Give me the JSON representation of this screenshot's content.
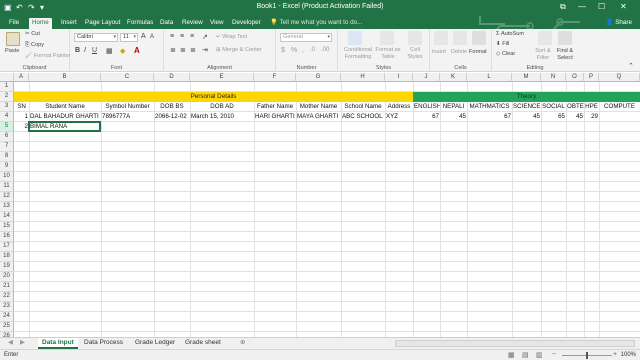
{
  "window": {
    "title": "Book1 - Excel (Product Activation Failed)",
    "controls": [
      "⧉",
      "—",
      "☐",
      "✕"
    ]
  },
  "ribbon_tabs": [
    "File",
    "Home",
    "Insert",
    "Page Layout",
    "Formulas",
    "Data",
    "Review",
    "View",
    "Developer"
  ],
  "tell_me": "Tell me what you want to do...",
  "share": "Share",
  "clipboard": {
    "paste": "Paste",
    "cut": "Cut",
    "copy": "Copy",
    "format_painter": "Format Painter",
    "label": "Clipboard"
  },
  "font": {
    "name": "Calibri",
    "size": "11",
    "label": "Font"
  },
  "alignment": {
    "wrap": "Wrap Text",
    "merge": "Merge & Center",
    "label": "Alignment"
  },
  "number": {
    "format": "General",
    "label": "Number"
  },
  "styles": {
    "conditional": "Conditional Formatting",
    "table": "Format as Table",
    "cell": "Cell Styles",
    "label": "Styles"
  },
  "cells": {
    "insert": "Insert",
    "delete": "Delete",
    "format": "Format",
    "label": "Cells"
  },
  "editing": {
    "autosum": "AutoSum",
    "fill": "Fill",
    "clear": "Clear",
    "sort": "Sort & Filter",
    "find": "Find & Select",
    "label": "Editing"
  },
  "name_box": "",
  "fx": "fx",
  "columns": [
    "A",
    "B",
    "C",
    "D",
    "E",
    "F",
    "G",
    "H",
    "I",
    "J",
    "K",
    "L",
    "M",
    "N",
    "O",
    "P",
    "Q"
  ],
  "rows": [
    "1",
    "2",
    "3",
    "4",
    "5",
    "6",
    "7",
    "8",
    "9",
    "10",
    "11",
    "12",
    "13",
    "14",
    "15",
    "16",
    "17",
    "18",
    "19",
    "20",
    "21",
    "22",
    "23",
    "24",
    "25",
    "26",
    "27"
  ],
  "bands": {
    "personal": "Personal Details",
    "theory": "Theory"
  },
  "headers": [
    "SN",
    "Student Name",
    "Symbol Number",
    "DOB BS",
    "DOB AD",
    "Father Name",
    "Mother Name",
    "School Name",
    "Address",
    "ENGLISH",
    "NEPALI",
    "MATHMATICS",
    "SCIENCE",
    "SOCIAL",
    "OBTE",
    "HPE",
    "COMPUTE"
  ],
  "data_rows": [
    {
      "sn": "1",
      "name": "DAL BAHADUR GHARTI",
      "symbol": "7896777A",
      "dob_bs": "2066-12-02",
      "dob_ad": "March 15, 2010",
      "father": "HARI GHARTI",
      "mother": "MAYA GHARTI",
      "school": "ABC SCHOOL",
      "address": "XYZ",
      "english": "67",
      "nepali": "45",
      "math": "67",
      "science": "45",
      "social": "65",
      "obte": "45",
      "hpe": "29",
      "computer": ""
    },
    {
      "sn": "2",
      "name": "BIMAL RANA"
    }
  ],
  "sheets": [
    "Data Input",
    "Data Process",
    "Grade Ledger",
    "Grade sheet"
  ],
  "status": {
    "mode": "Enter",
    "zoom": "100%"
  },
  "colors": {
    "accent": "#217346",
    "personal_band": "#ffd700",
    "theory_band": "#22a35a"
  }
}
